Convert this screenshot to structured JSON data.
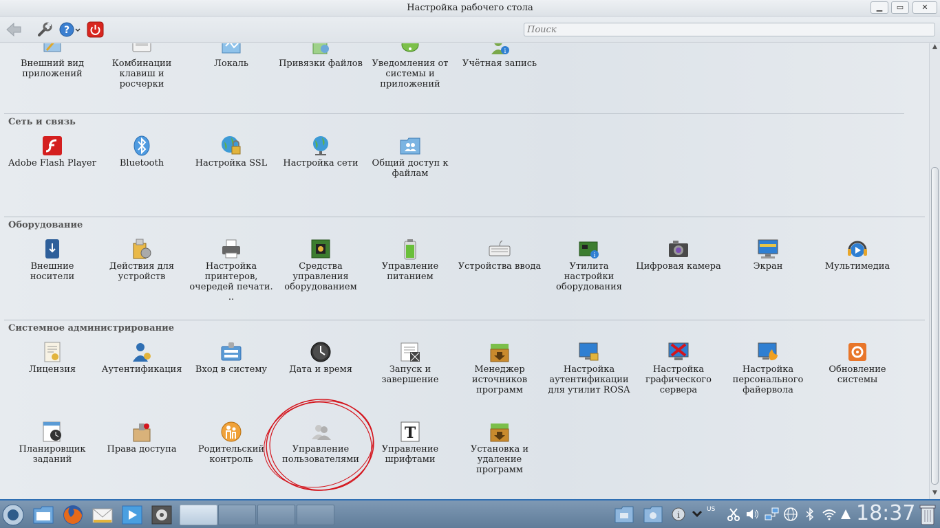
{
  "window": {
    "title": "Настройка рабочего стола",
    "min_icon": "minimize-icon",
    "max_icon": "maximize-icon",
    "close_icon": "close-icon"
  },
  "toolbar": {
    "search_placeholder": "Поиск"
  },
  "sections": [
    {
      "title": "",
      "items": [
        {
          "label": "Внешний вид приложений",
          "icon": "appearance-icon"
        },
        {
          "label": "Комбинации клавиш и росчерки",
          "icon": "keyboard-shortcuts-icon"
        },
        {
          "label": "Локаль",
          "icon": "locale-icon"
        },
        {
          "label": "Привязки файлов",
          "icon": "file-associations-icon"
        },
        {
          "label": "Уведомления от системы и приложений",
          "icon": "notifications-icon"
        },
        {
          "label": "Учётная запись",
          "icon": "account-icon"
        }
      ]
    },
    {
      "title": "Сеть и связь",
      "items": [
        {
          "label": "Adobe Flash Player",
          "icon": "flash-icon"
        },
        {
          "label": "Bluetooth",
          "icon": "bluetooth-icon"
        },
        {
          "label": "Настройка SSL",
          "icon": "ssl-icon"
        },
        {
          "label": "Настройка сети",
          "icon": "network-globe-icon"
        },
        {
          "label": "Общий доступ к файлам",
          "icon": "file-sharing-icon"
        }
      ]
    },
    {
      "title": "Оборудование",
      "items": [
        {
          "label": "Внешние носители",
          "icon": "removable-media-icon"
        },
        {
          "label": "Действия для устройств",
          "icon": "device-actions-icon"
        },
        {
          "label": "Настройка принтеров, очередей печати. ..",
          "icon": "printer-icon"
        },
        {
          "label": "Средства управления оборудованием",
          "icon": "hardware-tools-icon"
        },
        {
          "label": "Управление питанием",
          "icon": "battery-icon"
        },
        {
          "label": "Устройства ввода",
          "icon": "keyboard-icon"
        },
        {
          "label": "Утилита настройки оборудования",
          "icon": "hardware-config-icon"
        },
        {
          "label": "Цифровая камера",
          "icon": "camera-icon"
        },
        {
          "label": "Экран",
          "icon": "display-icon"
        },
        {
          "label": "Мультимедиа",
          "icon": "multimedia-icon"
        }
      ]
    },
    {
      "title": "Системное администрирование",
      "items": [
        {
          "label": "Лицензия",
          "icon": "license-icon"
        },
        {
          "label": "Аутентификация",
          "icon": "authentication-icon"
        },
        {
          "label": "Вход в систему",
          "icon": "login-icon"
        },
        {
          "label": "Дата и время",
          "icon": "clock-icon"
        },
        {
          "label": "Запуск и завершение",
          "icon": "startup-shutdown-icon"
        },
        {
          "label": "Менеджер источников программ",
          "icon": "package-sources-icon"
        },
        {
          "label": "Настройка аутентификации для утилит ROSA",
          "icon": "rosa-auth-icon"
        },
        {
          "label": "Настройка графического сервера",
          "icon": "graphics-server-icon"
        },
        {
          "label": "Настройка персонального файервола",
          "icon": "firewall-icon"
        },
        {
          "label": "Обновление системы",
          "icon": "system-update-icon"
        },
        {
          "label": "Планировщик заданий",
          "icon": "task-scheduler-icon"
        },
        {
          "label": "Права доступа",
          "icon": "permissions-icon"
        },
        {
          "label": "Родительский контроль",
          "icon": "parental-control-icon"
        },
        {
          "label": "Управление пользователями",
          "icon": "users-icon"
        },
        {
          "label": "Управление шрифтами",
          "icon": "fonts-icon"
        },
        {
          "label": "Установка и удаление программ",
          "icon": "install-remove-icon"
        }
      ]
    }
  ],
  "taskbar": {
    "keyboard_layout": "US",
    "clock": "18:37"
  },
  "colors": {
    "accent": "#2f6fb3",
    "annotation": "#d4141c"
  }
}
